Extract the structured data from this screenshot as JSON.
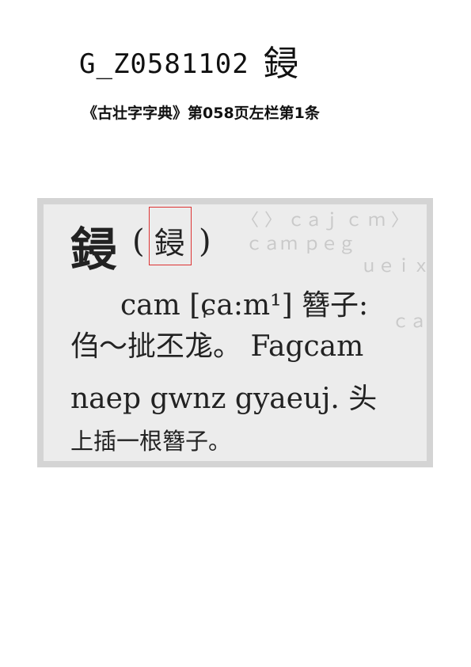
{
  "header": {
    "code": "G_Z0581102",
    "glyph": "鋟"
  },
  "source": "《古壮字字典》第058页左栏第1条",
  "entry": {
    "headword": "鋟",
    "paren_open": "(",
    "variant": "鋟",
    "paren_close": ")",
    "line1": "cam [ɕa:m¹] 簪子:",
    "line2": "㑇～㧗丕尨。 Fagcam",
    "line3": "naep gwnz gyaeuj. 头",
    "line4": "上插一根簪子。"
  },
  "colors": {
    "highlight_box": "#dd3333"
  }
}
